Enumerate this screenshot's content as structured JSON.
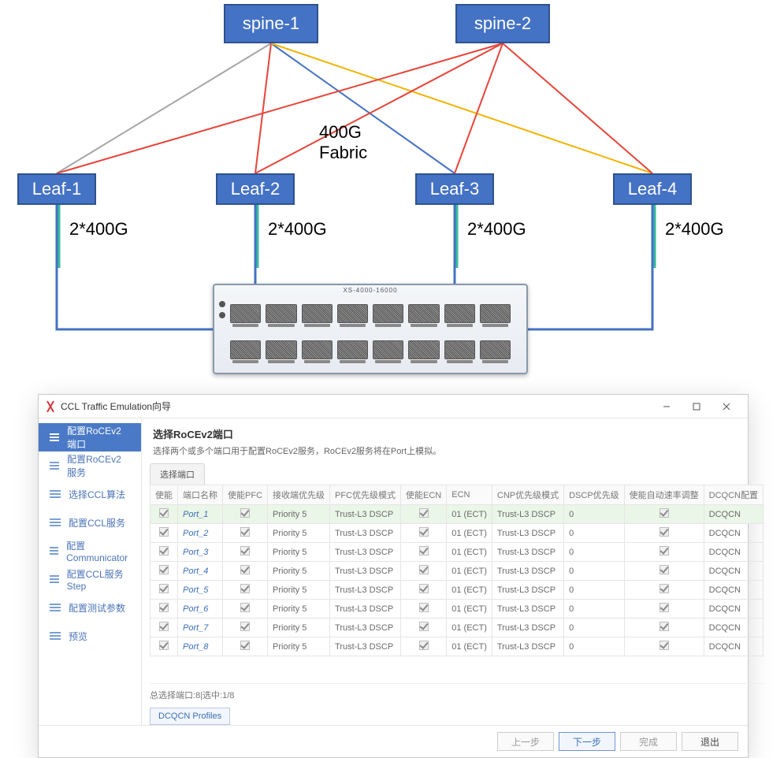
{
  "diagram": {
    "spines": [
      "spine-1",
      "spine-2"
    ],
    "leaves": [
      "Leaf-1",
      "Leaf-2",
      "Leaf-3",
      "Leaf-4"
    ],
    "fabric_label_line1": "400G",
    "fabric_label_line2": "Fabric",
    "leaf_bw_label": "2*400G",
    "device_model": "XS-4000-16000"
  },
  "dialog": {
    "title": "CCL Traffic Emulation向导",
    "sidebar": {
      "items": [
        {
          "label": "配置RoCEv2端口",
          "active": true
        },
        {
          "label": "配置RoCEv2服务"
        },
        {
          "label": "选择CCL算法"
        },
        {
          "label": "配置CCL服务"
        },
        {
          "label": "配置Communicator"
        },
        {
          "label": "配置CCL服务Step"
        },
        {
          "label": "配置测试参数"
        },
        {
          "label": "预览"
        }
      ]
    },
    "content": {
      "heading": "选择RoCEv2端口",
      "subheading": "选择两个或多个端口用于配置RoCEv2服务，RoCEv2服务将在Port上模拟。",
      "tab": "选择端口",
      "columns": [
        "使能",
        "端口名称",
        "使能PFC",
        "接收端优先级",
        "PFC优先级模式",
        "使能ECN",
        "ECN",
        "CNP优先级模式",
        "DSCP优先级",
        "使能自动速率调整",
        "DCQCN配置"
      ],
      "rows": [
        {
          "sel": true,
          "en": true,
          "name": "Port_1",
          "pfc": true,
          "rx": "Priority 5",
          "pfcmode": "Trust-L3 DSCP",
          "ecnEn": true,
          "ecn": "01 (ECT)",
          "cnp": "Trust-L3 DSCP",
          "dscp": "0",
          "auto": true,
          "dcqcn": "DCQCN"
        },
        {
          "en": true,
          "name": "Port_2",
          "pfc": true,
          "rx": "Priority 5",
          "pfcmode": "Trust-L3 DSCP",
          "ecnEn": true,
          "ecn": "01 (ECT)",
          "cnp": "Trust-L3 DSCP",
          "dscp": "0",
          "auto": true,
          "dcqcn": "DCQCN"
        },
        {
          "en": true,
          "name": "Port_3",
          "pfc": true,
          "rx": "Priority 5",
          "pfcmode": "Trust-L3 DSCP",
          "ecnEn": true,
          "ecn": "01 (ECT)",
          "cnp": "Trust-L3 DSCP",
          "dscp": "0",
          "auto": true,
          "dcqcn": "DCQCN"
        },
        {
          "en": true,
          "name": "Port_4",
          "pfc": true,
          "rx": "Priority 5",
          "pfcmode": "Trust-L3 DSCP",
          "ecnEn": true,
          "ecn": "01 (ECT)",
          "cnp": "Trust-L3 DSCP",
          "dscp": "0",
          "auto": true,
          "dcqcn": "DCQCN"
        },
        {
          "en": true,
          "name": "Port_5",
          "pfc": true,
          "rx": "Priority 5",
          "pfcmode": "Trust-L3 DSCP",
          "ecnEn": true,
          "ecn": "01 (ECT)",
          "cnp": "Trust-L3 DSCP",
          "dscp": "0",
          "auto": true,
          "dcqcn": "DCQCN"
        },
        {
          "en": true,
          "name": "Port_6",
          "pfc": true,
          "rx": "Priority 5",
          "pfcmode": "Trust-L3 DSCP",
          "ecnEn": true,
          "ecn": "01 (ECT)",
          "cnp": "Trust-L3 DSCP",
          "dscp": "0",
          "auto": true,
          "dcqcn": "DCQCN"
        },
        {
          "en": true,
          "name": "Port_7",
          "pfc": true,
          "rx": "Priority 5",
          "pfcmode": "Trust-L3 DSCP",
          "ecnEn": true,
          "ecn": "01 (ECT)",
          "cnp": "Trust-L3 DSCP",
          "dscp": "0",
          "auto": true,
          "dcqcn": "DCQCN"
        },
        {
          "en": true,
          "name": "Port_8",
          "pfc": true,
          "rx": "Priority 5",
          "pfcmode": "Trust-L3 DSCP",
          "ecnEn": true,
          "ecn": "01 (ECT)",
          "cnp": "Trust-L3 DSCP",
          "dscp": "0",
          "auto": true,
          "dcqcn": "DCQCN"
        }
      ],
      "total_label": "总选择端口:8|选中:1/8",
      "profiles_button": "DCQCN Profiles"
    },
    "footer": {
      "prev": "上一步",
      "next": "下一步",
      "finish": "完成",
      "exit": "退出"
    }
  },
  "chart_data": {
    "type": "diagram",
    "description": "Spine-leaf network topology with a 400G fabric between spine and leaf switches and 2*400G downlinks from each leaf to a 16-port switch device. The device connects to a CCL Traffic Emulation wizard configuring RoCEv2 ports.",
    "nodes": [
      {
        "id": "spine-1",
        "type": "spine"
      },
      {
        "id": "spine-2",
        "type": "spine"
      },
      {
        "id": "Leaf-1",
        "type": "leaf"
      },
      {
        "id": "Leaf-2",
        "type": "leaf"
      },
      {
        "id": "Leaf-3",
        "type": "leaf"
      },
      {
        "id": "Leaf-4",
        "type": "leaf"
      },
      {
        "id": "device",
        "type": "switch",
        "ports": 16
      }
    ],
    "edges": [
      {
        "from": "spine-1",
        "to": "Leaf-1",
        "speed": "400G",
        "color": "gray"
      },
      {
        "from": "spine-1",
        "to": "Leaf-2",
        "speed": "400G",
        "color": "red"
      },
      {
        "from": "spine-1",
        "to": "Leaf-3",
        "speed": "400G",
        "color": "blue"
      },
      {
        "from": "spine-1",
        "to": "Leaf-4",
        "speed": "400G",
        "color": "yellow"
      },
      {
        "from": "spine-2",
        "to": "Leaf-1",
        "speed": "400G",
        "color": "red"
      },
      {
        "from": "spine-2",
        "to": "Leaf-2",
        "speed": "400G",
        "color": "red"
      },
      {
        "from": "spine-2",
        "to": "Leaf-3",
        "speed": "400G",
        "color": "red"
      },
      {
        "from": "spine-2",
        "to": "Leaf-4",
        "speed": "400G",
        "color": "red"
      },
      {
        "from": "Leaf-1",
        "to": "device",
        "speed": "2*400G"
      },
      {
        "from": "Leaf-2",
        "to": "device",
        "speed": "2*400G"
      },
      {
        "from": "Leaf-3",
        "to": "device",
        "speed": "2*400G"
      },
      {
        "from": "Leaf-4",
        "to": "device",
        "speed": "2*400G"
      }
    ]
  }
}
